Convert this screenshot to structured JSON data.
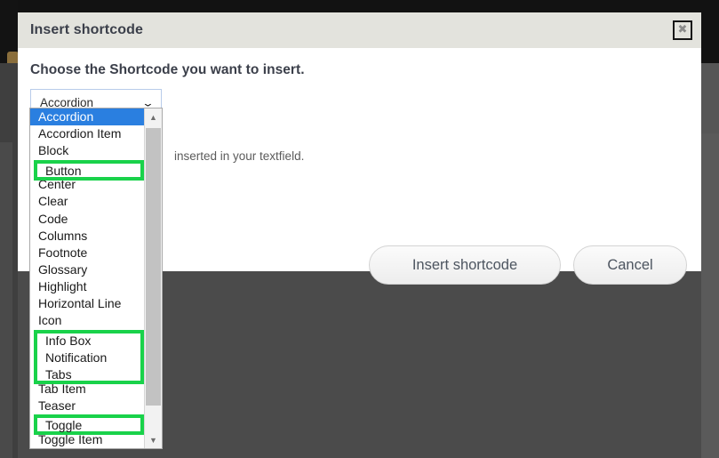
{
  "dialog": {
    "title": "Insert shortcode",
    "close_label": "✖",
    "heading": "Choose the Shortcode you want to insert.",
    "hint_text": "inserted in your textfield.",
    "insert_button": "Insert shortcode",
    "cancel_button": "Cancel"
  },
  "select": {
    "value": "Accordion",
    "chevron": "⌄"
  },
  "dropdown": {
    "selected": "Accordion",
    "options": [
      "Accordion",
      "Accordion Item",
      "Block",
      "Button",
      "Center",
      "Clear",
      "Code",
      "Columns",
      "Footnote",
      "Glossary",
      "Highlight",
      "Horizontal Line",
      "Icon",
      "Info Box",
      "Notification",
      "Tabs",
      "Tab Item",
      "Teaser",
      "Toggle",
      "Toggle Item"
    ],
    "scroll_up": "▲",
    "scroll_down": "▼"
  },
  "highlights": [
    {
      "label": "button-highlight",
      "items": [
        "Button"
      ],
      "color": "#19d24a"
    },
    {
      "label": "infobox-group-highlight",
      "items": [
        "Info Box",
        "Notification",
        "Tabs"
      ],
      "color": "#19d24a"
    },
    {
      "label": "toggle-highlight",
      "items": [
        "Toggle"
      ],
      "color": "#19d24a"
    }
  ],
  "colors": {
    "accent_green": "#19d24a",
    "selection_blue": "#2a7fe0",
    "header_beige": "#e3e3dd",
    "backdrop_gray": "#4b4b4b"
  }
}
